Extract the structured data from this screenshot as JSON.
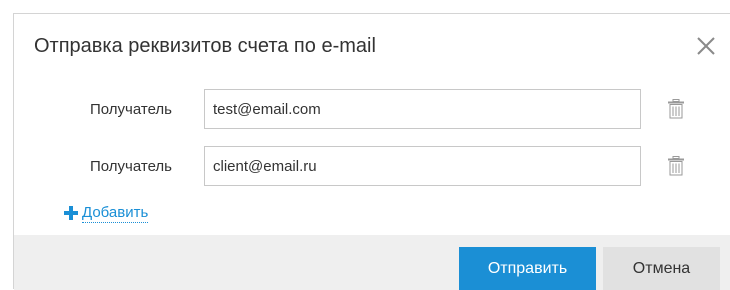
{
  "dialog": {
    "title": "Отправка реквизитов счета по e-mail"
  },
  "recipients": [
    {
      "label": "Получатель",
      "value": "test@email.com"
    },
    {
      "label": "Получатель",
      "value": "client@email.ru"
    }
  ],
  "add_link": {
    "label": "Добавить",
    "icon": "plus-icon"
  },
  "icons": {
    "close": "close-icon",
    "delete": "trash-icon"
  },
  "buttons": {
    "send": "Отправить",
    "cancel": "Отмена"
  },
  "colors": {
    "accent": "#1b8fd5",
    "link": "#1a8fd6",
    "footer_bg": "#efefef",
    "cancel_bg": "#e1e1e1"
  }
}
